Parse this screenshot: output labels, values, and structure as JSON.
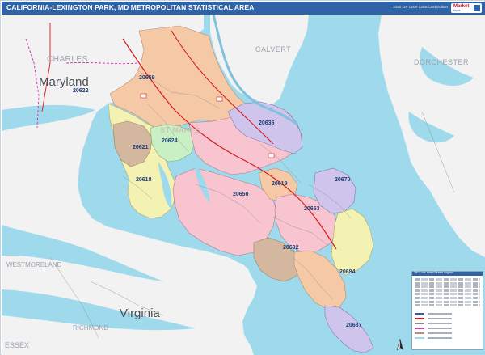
{
  "header": {
    "title": "CALIFORNIA-LEXINGTON PARK, MD METROPOLITAN STATISTICAL AREA",
    "subtitle": "2020 ZIP Code Color/Cast Edition",
    "brand": "Market Maps"
  },
  "colors": {
    "header_bg": "#2f63a6",
    "water": "#9fd9ec",
    "land": "#f2f2f2",
    "zip_orange": "#f6c9a6",
    "zip_pink": "#f7c4cf",
    "zip_lavender": "#cfc4ec",
    "zip_yellow": "#f4f2b3",
    "zip_green": "#c9efc5",
    "zip_brown": "#d3b89f",
    "highway_red": "#d7191c",
    "county_line": "#d23fb0"
  },
  "map": {
    "states": [
      "Maryland",
      "Virginia"
    ],
    "counties": [
      "CHARLES",
      "CALVERT",
      "DORCHESTER",
      "WESTMORELAND",
      "RICHMOND",
      "ESSEX"
    ],
    "focus_label": "ST MARYS",
    "zip_codes": [
      "20622",
      "20659",
      "20636",
      "20624",
      "20621",
      "20618",
      "20619",
      "20670",
      "20650",
      "20653",
      "20692",
      "20684",
      "20687"
    ]
  },
  "legend": {
    "title": "ZIP Code Index/Streets Legend",
    "icons": [
      "compass-north-icon",
      "highway-shield-icon"
    ]
  }
}
